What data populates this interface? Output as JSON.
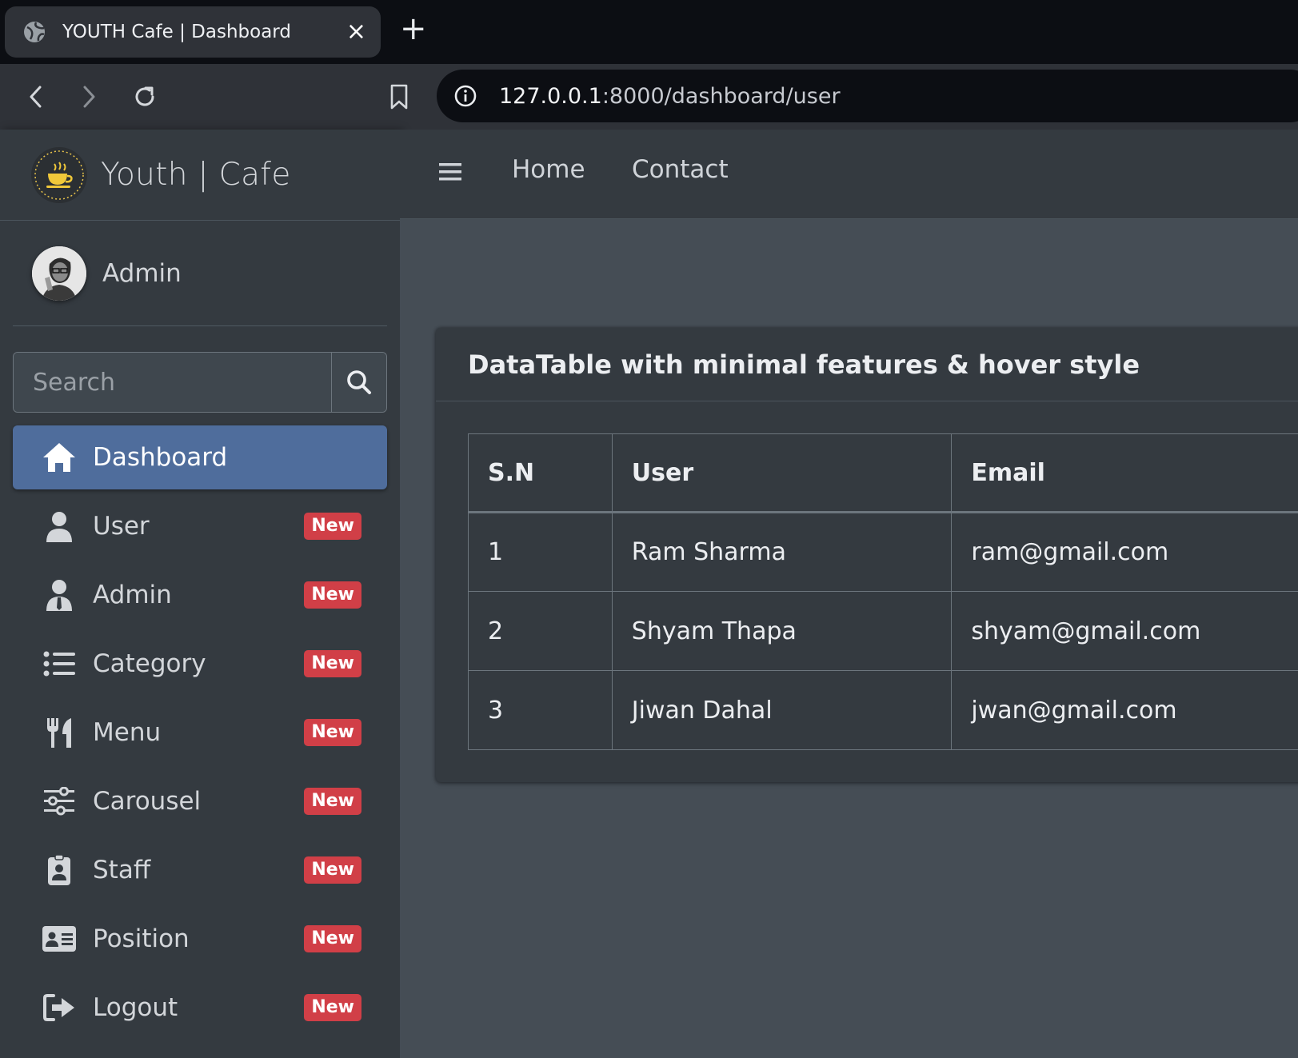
{
  "browser": {
    "tab_title": "YOUTH Cafe | Dashboard",
    "new_tab": "+",
    "url_host": "127.0.0.1",
    "url_path": ":8000/dashboard/user"
  },
  "sidebar": {
    "brand": "Youth | Cafe",
    "user_name": "Admin",
    "search_placeholder": "Search",
    "items": [
      {
        "label": "Dashboard",
        "icon": "home-icon",
        "active": true
      },
      {
        "label": "User",
        "icon": "user-icon",
        "badge": "New"
      },
      {
        "label": "Admin",
        "icon": "user-tie-icon",
        "badge": "New"
      },
      {
        "label": "Category",
        "icon": "list-icon",
        "badge": "New"
      },
      {
        "label": "Menu",
        "icon": "utensils-icon",
        "badge": "New"
      },
      {
        "label": "Carousel",
        "icon": "sliders-icon",
        "badge": "New"
      },
      {
        "label": "Staff",
        "icon": "id-badge-icon",
        "badge": "New"
      },
      {
        "label": "Position",
        "icon": "id-card-icon",
        "badge": "New"
      },
      {
        "label": "Logout",
        "icon": "sign-out-icon",
        "badge": "New"
      }
    ]
  },
  "topnav": {
    "home": "Home",
    "contact": "Contact"
  },
  "card": {
    "title": "DataTable with minimal features & hover style",
    "columns": [
      "S.N",
      "User",
      "Email"
    ],
    "rows": [
      [
        "1",
        "Ram Sharma",
        "ram@gmail.com"
      ],
      [
        "2",
        "Shyam Thapa",
        "shyam@gmail.com"
      ],
      [
        "3",
        "Jiwan Dahal",
        "jwan@gmail.com"
      ]
    ]
  },
  "colors": {
    "sidebar_bg": "#343a40",
    "content_bg": "#454d55",
    "active_item": "#4f6d9c",
    "badge": "#d13f47"
  }
}
